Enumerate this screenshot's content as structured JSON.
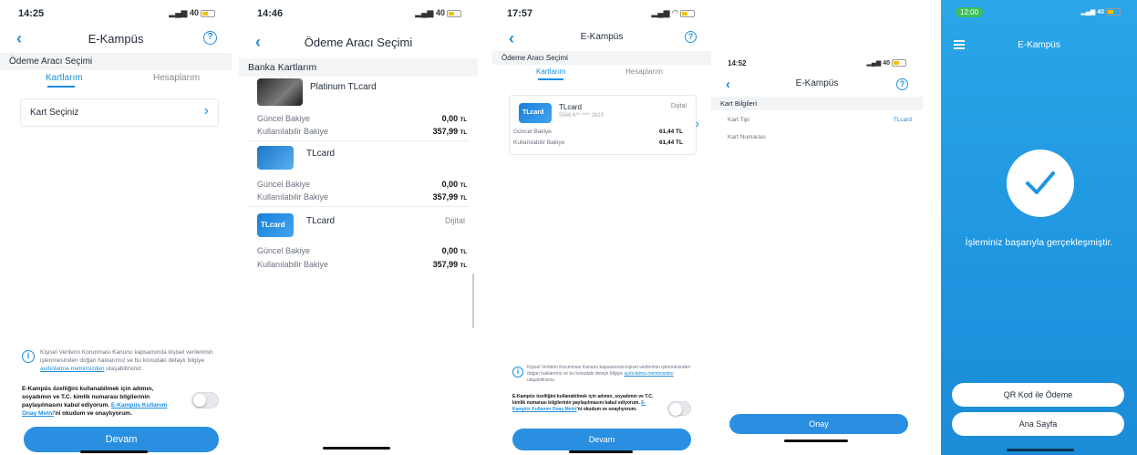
{
  "screen1": {
    "time": "14:25",
    "signal": "40",
    "title": "E-Kampüs",
    "section": "Ödeme Aracı Seçimi",
    "tabs": [
      "Kartlarım",
      "Hesaplarım"
    ],
    "select_card": "Kart Seçiniz",
    "info_text": "Kişisel Verilerin Korunması Kanunu kapsamında kişisel verilerimin işlenmesinden doğan haklarımız ve bu konudaki detaylı bilgiye",
    "info_link": "aydınlatma metnimizden",
    "info_tail": "ulaşabilirsiniz.",
    "consent_text": "E-Kampüs özelliğini kullanabilmek için adımın, soyadımın ve T.C. kimlik numarası bilgilerinin paylaşılmasını kabul ediyorum.",
    "consent_link": "E-Kampüs Kullanım Onay Metni",
    "consent_tail": "'ni okudum ve onaylıyorum.",
    "button": "Devam"
  },
  "screen2": {
    "time": "14:46",
    "signal": "40",
    "title": "Ödeme Aracı Seçimi",
    "section": "Banka Kartlarım",
    "cards": [
      {
        "name": "Platinum TLcard",
        "tag": "",
        "balance_label": "Güncel Bakiye",
        "balance": "0,00",
        "usable_label": "Kullanılabilir Bakiye",
        "usable": "357,99",
        "currency": "TL"
      },
      {
        "name": "TLcard",
        "tag": "",
        "balance_label": "Güncel Bakiye",
        "balance": "0,00",
        "usable_label": "Kullanılabilir Bakiye",
        "usable": "357,99",
        "currency": "TL"
      },
      {
        "name": "TLcard",
        "tag": "Dijital",
        "balance_label": "Güncel Bakiye",
        "balance": "0,00",
        "usable_label": "Kullanılabilir Bakiye",
        "usable": "357,99",
        "currency": "TL"
      }
    ],
    "card_logo": "TLcard"
  },
  "screen3": {
    "time": "17:57",
    "title": "E-Kampüs",
    "section": "Ödeme Aracı Seçimi",
    "tabs": [
      "Kartlarım",
      "Hesaplarım"
    ],
    "card_name": "TLcard",
    "card_tag": "Dijital",
    "card_number": "5546 6** **** 2819",
    "card_logo": "TLcard",
    "balance_label": "Güncel Bakiye",
    "balance": "61,44 TL",
    "usable_label": "Kullanılabilir Bakiye",
    "usable": "61,44 TL",
    "info_text": "Kişisel Verilerin Korunması Kanunu kapsamında kişisel verilerimin işlenmesinden doğan haklarımız ve bu konudaki detaylı bilgiye",
    "info_link": "aydınlatma metnimizden",
    "info_tail": "ulaşabilirsiniz.",
    "consent_text": "E-Kampüs özelliğini kullanabilmek için adımın, soyadımın ve T.C. kimlik numarası bilgilerinin paylaşılmasını kabul ediyorum.",
    "consent_link": "E-Kampüs Kullanım Onay Metni",
    "consent_tail": "'ni okudum ve onaylıyorum.",
    "button": "Devam"
  },
  "screen4": {
    "time": "14:52",
    "signal": "40",
    "title": "E-Kampüs",
    "section": "Kart Bilgileri",
    "card_type_label": "Kart Tipi",
    "card_type_value": "TLcard",
    "card_number_label": "Kart Numarası",
    "button": "Onay"
  },
  "screen5": {
    "time": "12:00",
    "signal": "40",
    "title": "E-Kampüs",
    "success": "İşleminiz başarıyla gerçekleşmiştir.",
    "qr_button": "QR Kod ile Ödeme",
    "home_button": "Ana Sayfa"
  },
  "colors": {
    "accent": "#2a8fe0",
    "success_bg": "#2aa6e8"
  }
}
